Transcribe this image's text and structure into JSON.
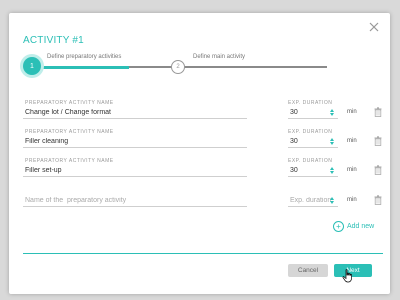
{
  "modal": {
    "title": "ACTIVITY #1"
  },
  "stepper": {
    "steps": [
      {
        "number": "1",
        "label": "Define preparatory activities",
        "state": "active"
      },
      {
        "number": "2",
        "label": "Define main activity",
        "state": "pending"
      }
    ],
    "progress": 0.5
  },
  "form": {
    "name_label": "PREPARATORY ACTIVITY NAME",
    "duration_label": "EXP. DURATION",
    "unit": "min",
    "rows": [
      {
        "name": "Change lot / Change format",
        "duration": "30"
      },
      {
        "name": "Filler cleaning",
        "duration": "30"
      },
      {
        "name": "Filler set-up",
        "duration": "30"
      }
    ],
    "new_row": {
      "name_placeholder": "Name of the  preparatory activity",
      "duration_placeholder": "Exp. duration"
    },
    "add_new_label": "Add new"
  },
  "footer": {
    "cancel_label": "Cancel",
    "next_label": "Next"
  },
  "colors": {
    "accent": "#2bbfb6",
    "cancel_bg": "#d6d6d6"
  },
  "icons": {
    "close": "close-icon",
    "trash": "trash-icon",
    "add": "plus-circle-icon",
    "cursor": "hand-pointer-icon"
  }
}
